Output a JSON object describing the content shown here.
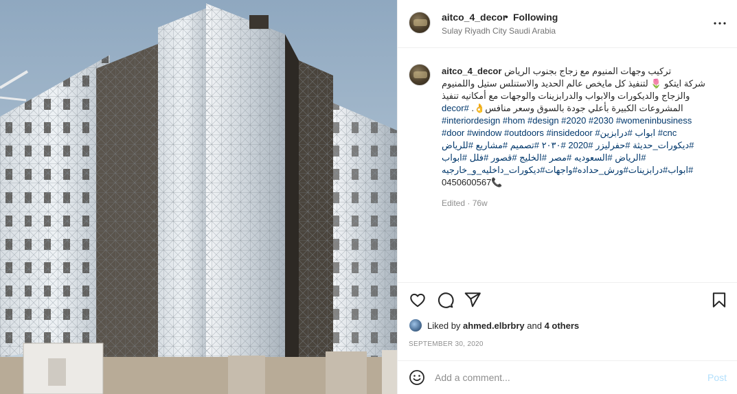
{
  "post": {
    "username": "aitco_4_decor",
    "separator": "•",
    "follow_status": "Following",
    "location": "Sulay Riyadh City Saudi Arabia"
  },
  "caption": {
    "line1_arabic": "تركيب وجهات المنيوم مع زجاج بجنوب الرياض",
    "line2": "شركة ايتكو 🌷 لتنفيذ كل مايخص عالم الحديد والاستنلس ستيل واللمنيوم",
    "line3": "والزجاج والديكورات والابواب والدرابزينات والوجهات مع أمكانيه تنفيذ",
    "line4_text": "المشروعات الكبيرة بأعلي جودة بالسوق وسعر منافس👌.",
    "line4_hash": "#decor",
    "line5": "#interiordesign #hom #design #2020 #2030 #womeninbusiness",
    "line6": "#door #window #outdoors #insidedoor #ابواب #درابزين #cnc",
    "line7": "#ديكورات_حديثة #حفرليزر #2020 #٢٠٣٠ #تصميم #مشاريع #للرياض",
    "line8": "#الرياض #السعوديه #مصر #الخليج #قصور #فلل #ابواب",
    "line9": "#ابواب#درابزينات#ورش_حداده#واجهات#ديكورات_داخليه_و_خارجيه",
    "line10": "0450600567📞"
  },
  "edited_label": "Edited · 76w",
  "likes": {
    "prefix": "Liked by ",
    "user": "ahmed.elbrbry",
    "middle": " and ",
    "others": "4 others"
  },
  "date": "SEPTEMBER 30, 2020",
  "comment": {
    "placeholder": "Add a comment...",
    "post_label": "Post"
  },
  "icons": {
    "more": "more-options-icon",
    "like": "heart-icon",
    "comment": "comment-icon",
    "share": "share-icon",
    "save": "bookmark-icon",
    "emoji": "emoji-icon"
  },
  "colors": {
    "hashtag": "#00376b",
    "post_button_disabled": "#b2dffc",
    "muted_text": "#8e8e8e"
  }
}
